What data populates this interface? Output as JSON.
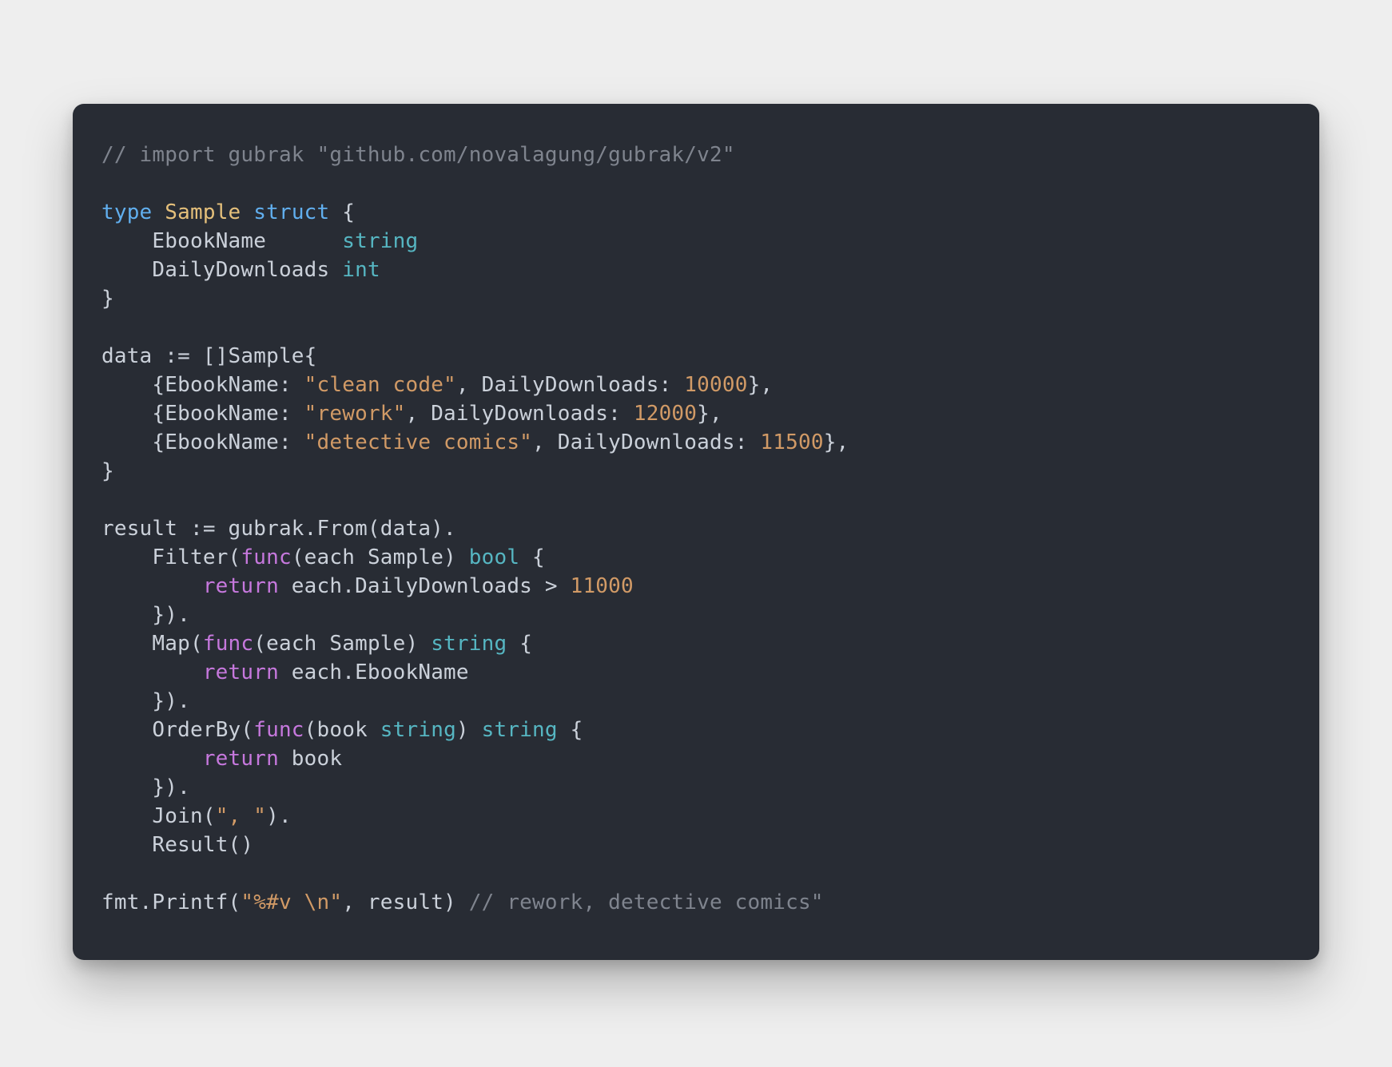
{
  "code": {
    "comment_import": "// import gubrak \"github.com/novalagung/gubrak/v2\"",
    "kw_type": "type",
    "name_sample": "Sample",
    "kw_struct": "struct",
    "brace_open": "{",
    "field_ebook": "EbookName",
    "type_string": "string",
    "field_daily": "DailyDownloads",
    "type_int": "int",
    "brace_close": "}",
    "data_decl": "data := []Sample{",
    "row0_pre": "{EbookName: ",
    "row0_str": "\"clean code\"",
    "row0_mid": ", DailyDownloads: ",
    "row0_num": "10000",
    "rowe": "},",
    "row1_str": "\"rework\"",
    "row1_num": "12000",
    "row2_str": "\"detective comics\"",
    "row2_num": "11500",
    "result_decl": "result := gubrak.From(data).",
    "filter_pre": "Filter(",
    "func_kw": "func",
    "filter_args": "(each Sample) ",
    "bool_kw": "bool",
    "open_brace_space": " {",
    "return_kw": "return",
    "filter_body": " each.DailyDownloads > ",
    "filter_num": "11000",
    "close_block": "}).",
    "map_pre": "Map(",
    "map_args": "(each Sample) ",
    "map_ret_type": "string",
    "map_body": " each.EbookName",
    "orderby_pre": "OrderBy(",
    "orderby_args": "(book ",
    "orderby_argtype": "string",
    "orderby_close_args": ") ",
    "orderby_ret_type": "string",
    "orderby_body": " book",
    "join_pre": "Join(",
    "join_str": "\", \"",
    "join_post": ").",
    "result_call": "Result()",
    "printf_pre": "fmt.Printf(",
    "printf_fmt": "\"%#v \\n\"",
    "printf_post": ", result) ",
    "printf_comment": "// rework, detective comics\""
  }
}
